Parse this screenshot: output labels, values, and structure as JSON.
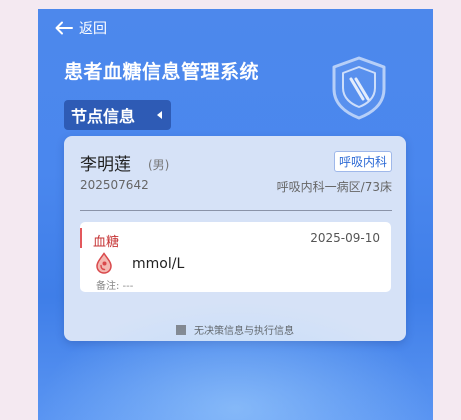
{
  "header": {
    "back_label": "返回",
    "system_title": "患者血糖信息管理系统",
    "node_tab_label": "节点信息"
  },
  "patient": {
    "name": "李明莲",
    "gender": "(男)",
    "department_badge": "呼吸内科",
    "patient_id": "202507642",
    "ward_bed": "呼吸内科一病区/73床"
  },
  "record": {
    "type": "血糖",
    "date": "2025-09-10",
    "unit": "mmol/L",
    "note": "备注: ---"
  },
  "footer": {
    "no_decision_text": "无决策信息与执行信息"
  },
  "colors": {
    "header_blue": "#4a87ee",
    "tab_blue": "#2e5bb5",
    "card_bg": "#d6e2f7",
    "accent_red": "#e3585c"
  }
}
